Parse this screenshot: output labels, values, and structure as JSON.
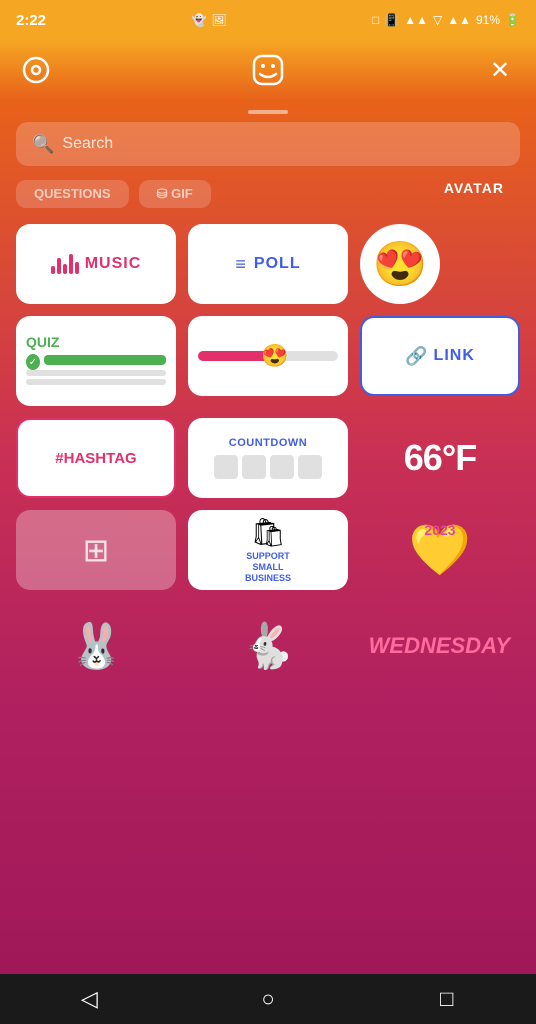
{
  "statusBar": {
    "time": "2:22",
    "batteryPercent": "91%"
  },
  "topBar": {
    "settingsIcon": "⊙",
    "stickerIcon": "🙂",
    "closeIcon": "✕"
  },
  "search": {
    "placeholder": "Search"
  },
  "partialRow": {
    "questions": "QUESTIONS",
    "gif": "⛁ GIF"
  },
  "avatarLabel": "AVATAR",
  "stickers": {
    "music": "MUSIC",
    "poll": "POLL",
    "quiz": "QUIZ",
    "link": "LINK",
    "hashtag": "#HASHTAG",
    "countdown": "COUNTDOWN",
    "temperature": "66°F",
    "supportBusiness": "SUPPORT\nSMALL\nBUSINESS",
    "wednesday": "WEDNESDAY"
  },
  "navBar": {
    "back": "◁",
    "home": "○",
    "square": "□"
  }
}
